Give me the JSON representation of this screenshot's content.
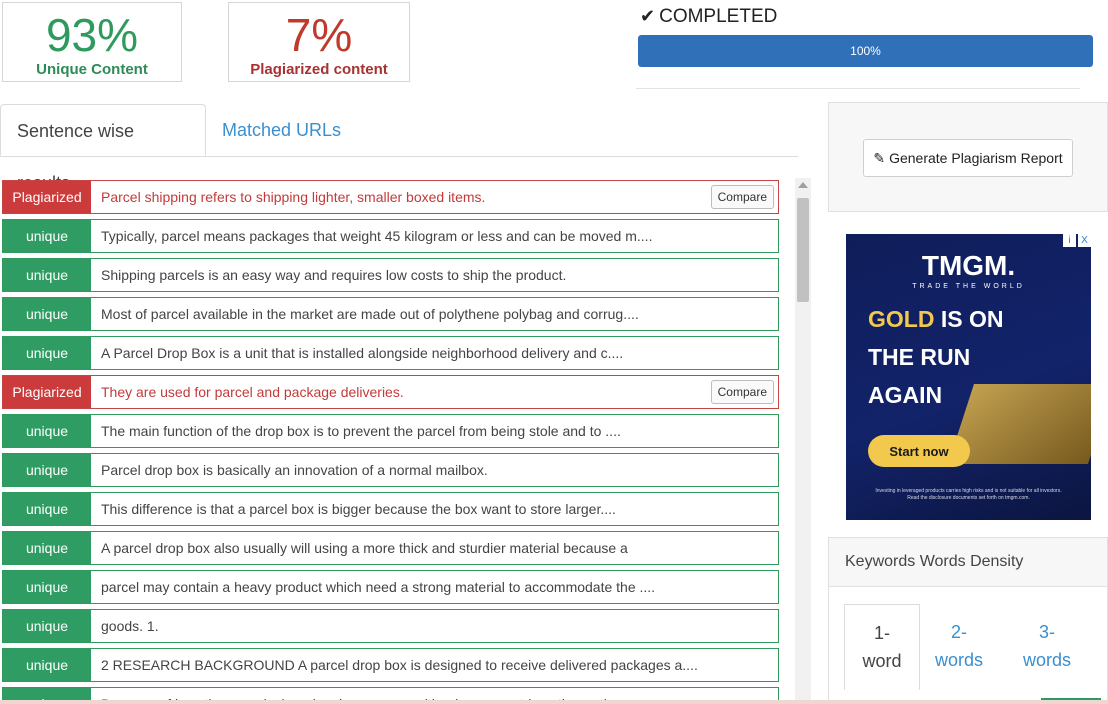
{
  "stats": {
    "unique": {
      "value": "93%",
      "label": "Unique Content"
    },
    "plagiarized": {
      "value": "7%",
      "label": "Plagiarized content"
    }
  },
  "status": {
    "label": "COMPLETED",
    "progress_text": "100%",
    "progress_fraction": 1.0
  },
  "tabs": {
    "sentence": "Sentence wise results",
    "urls": "Matched URLs"
  },
  "compare_label": "Compare",
  "rows": [
    {
      "status": "Plagiarized",
      "text": "Parcel shipping refers to shipping lighter, smaller boxed items."
    },
    {
      "status": "unique",
      "text": "Typically, parcel means packages that weight 45 kilogram or less and can be moved m...."
    },
    {
      "status": "unique",
      "text": "Shipping parcels is an easy way and requires low costs to ship the product."
    },
    {
      "status": "unique",
      "text": "Most of parcel available in the market are made out of polythene polybag and corrug...."
    },
    {
      "status": "unique",
      "text": "A Parcel Drop Box is a unit that is installed alongside neighborhood delivery and c...."
    },
    {
      "status": "Plagiarized",
      "text": "They are used for parcel and package deliveries."
    },
    {
      "status": "unique",
      "text": "The main function of the drop box is to prevent the parcel from being stole and to ...."
    },
    {
      "status": "unique",
      "text": "Parcel drop box is basically an innovation of a normal mailbox."
    },
    {
      "status": "unique",
      "text": "This difference is that a parcel box is bigger because the box want to store larger...."
    },
    {
      "status": "unique",
      "text": "A parcel drop box also usually will using a more thick and sturdier material because a"
    },
    {
      "status": "unique",
      "text": "parcel may contain a heavy product which need a strong material to accommodate the ...."
    },
    {
      "status": "unique",
      "text": "goods. 1."
    },
    {
      "status": "unique",
      "text": "2 RESEARCH BACKGROUND A parcel drop box is designed to receive delivered packages a...."
    },
    {
      "status": "unique",
      "text": "Because of how they are designed, only someone with a key can retrieve the packages."
    }
  ],
  "report_button": "Generate Plagiarism Report",
  "ad": {
    "brand": "TMGM.",
    "tagline": "TRADE THE WORLD",
    "headline_gold": "GOLD",
    "headline_line1_rest": " IS ON",
    "headline_line2": "THE RUN",
    "headline_line3": "AGAIN",
    "cta": "Start now",
    "disclaimer_1": "Investing in leveraged products carries high risks and is not suitable for all investors.",
    "disclaimer_2": "Read the disclosure documents set forth on tmgm.com.",
    "info_icon": "i",
    "close_icon": "X"
  },
  "keywords": {
    "title": "Keywords Words Density",
    "tab1": {
      "num": "1-",
      "word": "word"
    },
    "tab2": {
      "num": "2-",
      "word": "words"
    },
    "tab3": {
      "num": "3-",
      "word": "words"
    }
  }
}
